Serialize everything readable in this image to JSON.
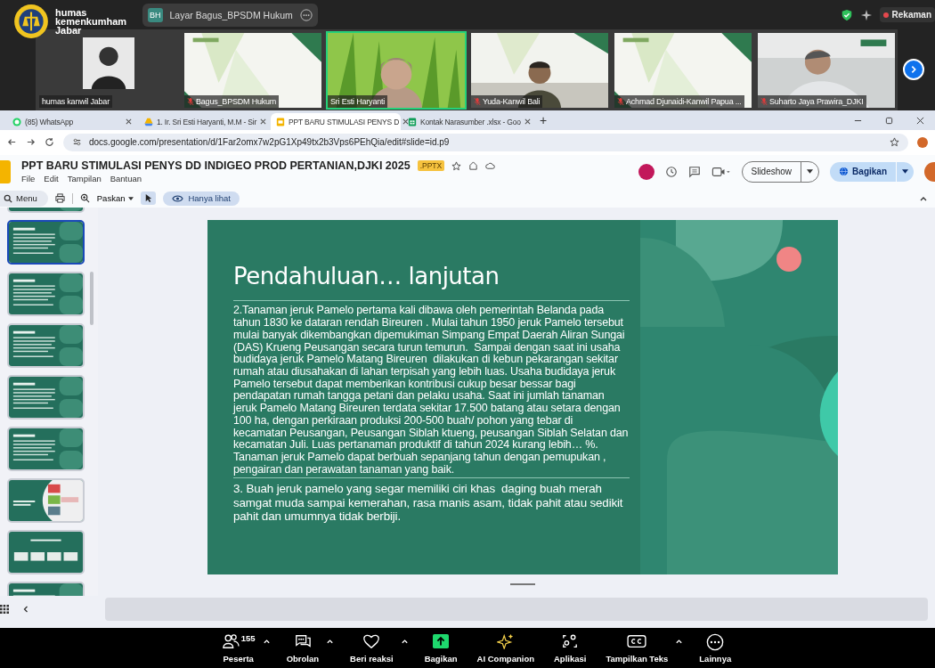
{
  "meeting": {
    "logo_lines": [
      "humas",
      "kemenkumham",
      "Jabar"
    ],
    "share_tab": {
      "initials": "BH",
      "label": "Layar Bagus_BPSDM Hukum"
    },
    "recording": {
      "label": "Rekaman"
    }
  },
  "participants": [
    {
      "name": "humas kanwil Jabar",
      "kind": "avatar",
      "muted": false,
      "selected": false
    },
    {
      "name": "Bagus_BPSDM Hukum",
      "kind": "picture",
      "muted": true,
      "selected": false
    },
    {
      "name": "Sri Esti Haryanti",
      "kind": "picture",
      "muted": false,
      "selected": true
    },
    {
      "name": "Yuda-Kanwil Bali",
      "kind": "picture",
      "muted": true,
      "selected": false
    },
    {
      "name": "Achmad Djunaidi-Kanwil Papua ...",
      "kind": "picture",
      "muted": true,
      "selected": false
    },
    {
      "name": "Suharto Jaya Prawira_DJKI",
      "kind": "picture",
      "muted": true,
      "selected": false
    }
  ],
  "browser": {
    "tabs": [
      {
        "label": "(85) WhatsApp",
        "kind": "chat",
        "selected": false
      },
      {
        "label": "1. Ir. Sri Esti Haryanti, M.M - Sir",
        "kind": "drive",
        "selected": false
      },
      {
        "label": "PPT BARU STIMULASI PENYS D",
        "kind": "slides",
        "selected": true
      },
      {
        "label": "Kontak Narasumber .xlsx - Goo",
        "kind": "sheets",
        "selected": false
      }
    ],
    "new_tab": "+",
    "url": "docs.google.com/presentation/d/1Far2omx7w2pG1Xp49tx2b3Vps6PEhQia/edit#slide=id.p9"
  },
  "doc": {
    "title": "PPT BARU STIMULASI PENYS DD INDIGEO PROD PERTANIAN,DJKI 2025",
    "badge": ".PPTX",
    "menu": [
      "File",
      "Edit",
      "Tampilan",
      "Bantuan"
    ],
    "slideshow": "Slideshow",
    "share": "Bagikan",
    "menu_search": "Menu",
    "zoom": "Paskan",
    "view_mode": "Hanya lihat"
  },
  "thumbnails": [
    {
      "kind": "text",
      "selected": false
    },
    {
      "kind": "text",
      "selected": true
    },
    {
      "kind": "text",
      "selected": false
    },
    {
      "kind": "text",
      "selected": false
    },
    {
      "kind": "text",
      "selected": false
    },
    {
      "kind": "text",
      "selected": false
    },
    {
      "kind": "diagram",
      "selected": false
    },
    {
      "kind": "boxes",
      "selected": false
    },
    {
      "kind": "text",
      "selected": false
    }
  ],
  "slide": {
    "title": "Pendahuluan… lanjutan",
    "paragraphs": [
      "2.Tanaman jeruk Pamelo pertama kali dibawa oleh pemerintah Belanda pada tahun 1830 ke dataran rendah Bireuren . Mulai tahun 1950 jeruk Pamelo tersebut mulai banyak dikembangkan dipemukiman Simpang Empat Daerah Aliran Sungai (DAS) Krueng Peusangan secara turun temurun.  Sampai dengan saat ini usaha budidaya jeruk Pamelo Matang Bireuren  dilakukan di kebun pekarangan sekitar rumah atau diusahakan di lahan terpisah yang lebih luas. Usaha budidaya jeruk Pamelo tersebut dapat memberikan kontribusi cukup besar bessar bagi pendapatan rumah tangga petani dan pelaku usaha. Saat ini jumlah tanaman jeruk Pamelo Matang Bireuren terdata sekitar 17.500 batang atau setara dengan 100 ha, dengan perkiraan produksi 200-500 buah/ pohon yang tebar di  kecamatan Peusangan, Peusangan Siblah ktueng, peusangan Siblah Selatan dan kecamatan Juli. Luas pertanaman produktif di tahun 2024 kurang lebih… %. Tanaman jeruk Pamelo dapat berbuah sepanjang tahun dengan pemupukan , pengairan dan perawatan tanaman yang baik.",
      "3. Buah jeruk pamelo yang segar memiliki ciri khas  daging buah merah samgat muda sampai kemerahan, rasa manis asam, tidak pahit atau sedikit pahit dan umumnya tidak berbiji."
    ]
  },
  "controls": [
    {
      "kind": "people",
      "label": "Peserta",
      "count": "155",
      "caret": true
    },
    {
      "kind": "chat",
      "label": "Obrolan",
      "caret": true
    },
    {
      "kind": "heart",
      "label": "Beri reaksi",
      "caret": true
    },
    {
      "kind": "share",
      "label": "Bagikan",
      "caret": false
    },
    {
      "kind": "sparkle",
      "label": "AI Companion",
      "caret": false
    },
    {
      "kind": "apps",
      "label": "Aplikasi",
      "caret": false
    },
    {
      "kind": "cc",
      "label": "Tampilkan Teks",
      "caret": true
    },
    {
      "kind": "more",
      "label": "Lainnya",
      "caret": false
    }
  ]
}
